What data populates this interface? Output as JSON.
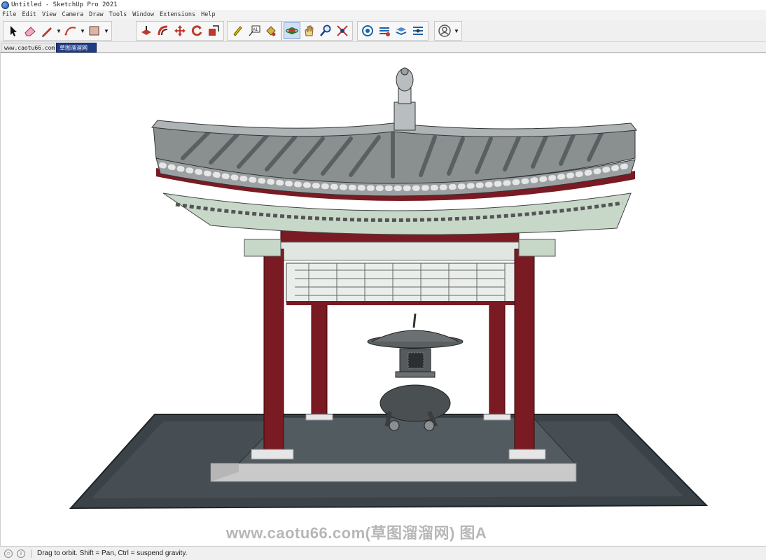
{
  "window": {
    "title": "Untitled - SketchUp Pro 2021"
  },
  "menu": [
    "File",
    "Edit",
    "View",
    "Camera",
    "Draw",
    "Tools",
    "Window",
    "Extensions",
    "Help"
  ],
  "toolbar": {
    "tools": [
      {
        "name": "select-tool",
        "icon": "arrow-cursor-icon"
      },
      {
        "name": "eraser-tool",
        "icon": "eraser-icon"
      },
      {
        "name": "line-tool",
        "icon": "pencil-icon",
        "dropdown": true
      },
      {
        "name": "arc-tool",
        "icon": "arc-icon",
        "dropdown": true
      },
      {
        "name": "rectangle-tool",
        "icon": "rectangle-icon",
        "dropdown": true
      },
      {
        "name": "push-pull-tool",
        "icon": "push-pull-icon"
      },
      {
        "name": "offset-tool",
        "icon": "offset-icon"
      },
      {
        "name": "move-tool",
        "icon": "move-icon"
      },
      {
        "name": "rotate-tool",
        "icon": "rotate-icon"
      },
      {
        "name": "scale-tool",
        "icon": "scale-icon"
      },
      {
        "name": "tape-measure-tool",
        "icon": "tape-measure-icon"
      },
      {
        "name": "text-tool",
        "icon": "text-icon"
      },
      {
        "name": "paint-bucket-tool",
        "icon": "paint-bucket-icon"
      },
      {
        "name": "orbit-tool",
        "icon": "orbit-icon",
        "active": true
      },
      {
        "name": "pan-tool",
        "icon": "hand-icon"
      },
      {
        "name": "zoom-tool",
        "icon": "magnifier-icon"
      },
      {
        "name": "zoom-extents-tool",
        "icon": "zoom-extents-icon"
      },
      {
        "name": "3d-warehouse",
        "icon": "warehouse-icon"
      },
      {
        "name": "extension-warehouse",
        "icon": "extension-icon"
      },
      {
        "name": "layout",
        "icon": "layout-icon"
      },
      {
        "name": "extension-manager",
        "icon": "extension-manager-icon"
      },
      {
        "name": "account",
        "icon": "user-icon",
        "dropdown": true
      }
    ]
  },
  "scenes": {
    "tab1": "www.caotu66.com",
    "tab2": "草图溜溜网"
  },
  "viewport": {
    "watermark": "www.caotu66.com(草图溜溜网) 图A"
  },
  "status": {
    "hint": "Drag to orbit. Shift = Pan, Ctrl = suspend gravity."
  },
  "colors": {
    "column": "#7a1a22",
    "roof": "#8a9090",
    "eave_green": "#c7d8c9",
    "floor": "#3c4448",
    "selected_tab": "#1f3d86"
  }
}
